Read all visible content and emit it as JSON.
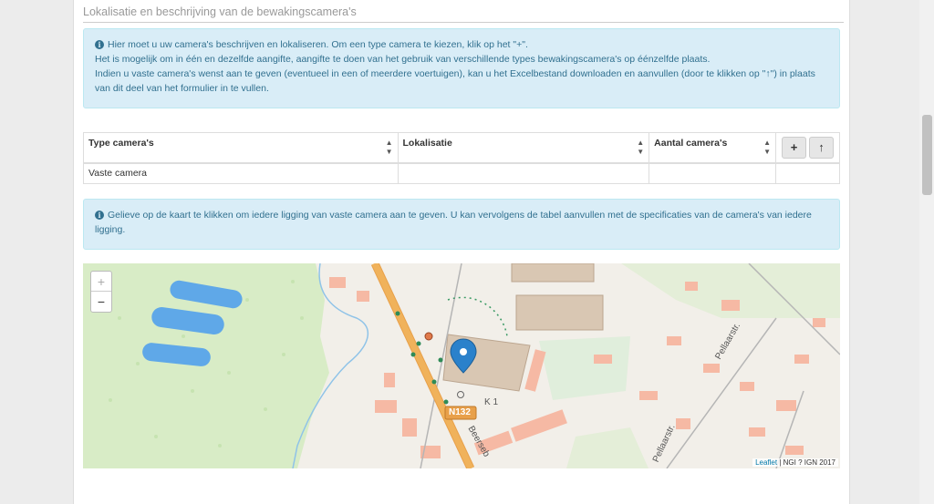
{
  "section": {
    "title": "Lokalisatie en beschrijving van de bewakingscamera's"
  },
  "info1": {
    "line1": "Hier moet u uw camera's beschrijven en lokaliseren. Om een type camera te kiezen, klik op het \"+\".",
    "line2": "Het is mogelijk om in één en dezelfde aangifte, aangifte te doen van het gebruik van verschillende types bewakingscamera's op éénzelfde plaats.",
    "line3": "Indien u vaste camera's wenst aan te geven (eventueel in een of meerdere voertuigen), kan u het Excelbestand downloaden en aanvullen (door te klikken op \"↑\") in plaats van dit deel van het formulier in te vullen."
  },
  "table": {
    "headers": [
      "Type camera's",
      "Lokalisatie",
      "Aantal camera's"
    ],
    "add_button": "+",
    "upload_button": "↑",
    "rows": [
      {
        "type": "Vaste camera",
        "location": "",
        "count": ""
      }
    ]
  },
  "info2": {
    "text": "Gelieve op de kaart te klikken om iedere ligging van vaste camera aan te geven. U kan vervolgens de tabel aanvullen met de specificaties van de camera's van iedere ligging."
  },
  "map": {
    "zoom_in": "+",
    "zoom_out": "−",
    "road_label": "N132",
    "street1": "Beerseb",
    "street2": "Pellaarstr.",
    "street3": "Pellaarstr.",
    "area_label": "K 1",
    "attribution_link": "Leaflet",
    "attribution_text": " | NGI ? IGN 2017"
  },
  "colors": {
    "info_bg": "#d9edf7",
    "info_text": "#31708f",
    "marker": "#2a81cb",
    "road": "#f0b25b"
  }
}
